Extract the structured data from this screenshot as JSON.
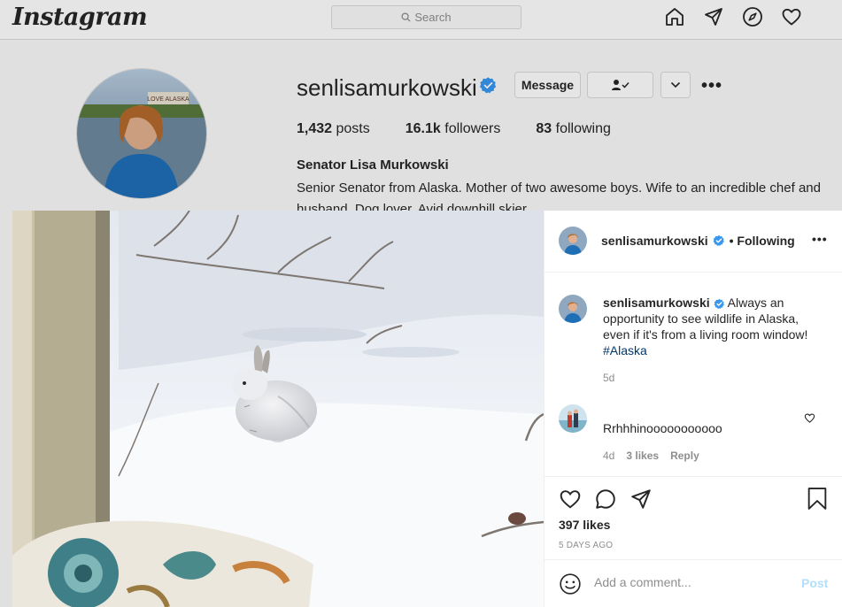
{
  "header": {
    "logo": "Instagram",
    "search_placeholder": "Search",
    "nav_icons": [
      "home-icon",
      "direct-icon",
      "explore-icon",
      "activity-heart-icon"
    ]
  },
  "profile": {
    "username": "senlisamurkowski",
    "message_label": "Message",
    "following_button_icon": "person-check-icon",
    "posts_count": "1,432",
    "posts_label": "posts",
    "followers_count": "16.1k",
    "followers_label": "followers",
    "following_count": "83",
    "following_label": "following",
    "full_name": "Senator Lisa Murkowski",
    "bio": "Senior Senator from Alaska. Mother of two awesome boys. Wife to an incredible chef and husband. Dog lover. Avid downhill skier.",
    "avatar_sign": "LOVE ALASKA"
  },
  "post": {
    "author": "senlisamurkowski",
    "follow_status": "• Following",
    "caption_text": "Always an opportunity to see wildlife in Alaska, even if it's from a living room window!",
    "caption_hashtag": "#Alaska",
    "caption_time": "5d",
    "comments": [
      {
        "text": "Rrhhhinooooooooooo",
        "time": "4d",
        "likes": "3 likes",
        "reply_label": "Reply"
      }
    ],
    "likes": "397 likes",
    "time_ago": "5 DAYS AGO",
    "comment_placeholder": "Add a comment...",
    "post_label": "Post"
  },
  "colors": {
    "verified_blue": "#3897f0",
    "hashtag": "#00376b",
    "post_button_disabled": "#b2dffc"
  }
}
